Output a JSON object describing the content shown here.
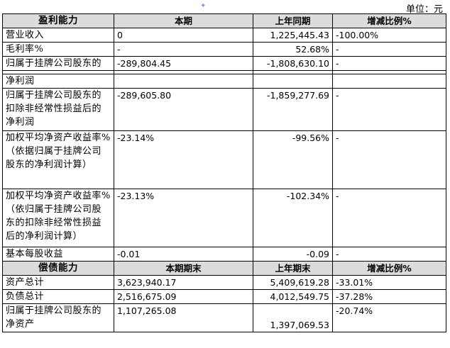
{
  "unit_label": "单位：元",
  "decor_mark": "✦",
  "profit": {
    "headers": [
      "盈利能力",
      "本期",
      "上年同期",
      "增减比例%"
    ],
    "rows": [
      {
        "label": "营业收入",
        "current": "0",
        "previous": "1,225,445.43",
        "change": "-100.00%"
      },
      {
        "label": "毛利率%",
        "current": "-",
        "previous": "52.68%",
        "change": "-"
      },
      {
        "label": "归属于挂牌公司股东的",
        "current": "-289,804.45",
        "previous": "-1,808,630.10",
        "change": "-"
      },
      {
        "label": "净利润",
        "current": "",
        "previous": "",
        "change": ""
      },
      {
        "label": "归属于挂牌公司股东的扣除非经常性损益后的净利润",
        "current": "-289,605.80",
        "previous": "-1,859,277.69",
        "change": "-"
      },
      {
        "label": "加权平均净资产收益率%（依据归属于挂牌公司股东的净利润计算）",
        "current": "-23.14%",
        "previous": "-99.56%",
        "change": "-"
      },
      {
        "label": "加权平均净资产收益率%（依归属于挂牌公司股东的扣除非经常性损益后的净利润计算）",
        "current": "-23.13%",
        "previous": "-102.34%",
        "change": "-"
      },
      {
        "label": "基本每股收益",
        "current": "-0.01",
        "previous": "-0.09",
        "change": "-"
      }
    ]
  },
  "solvency": {
    "headers": [
      "偿债能力",
      "本期期末",
      "上年期末",
      "增减比例%"
    ],
    "rows": [
      {
        "label": "资产总计",
        "current": "3,623,940.17",
        "previous": "5,409,619.28",
        "change": "-33.01%"
      },
      {
        "label": "负债总计",
        "current": "2,516,675.09",
        "previous": "4,012,549.75",
        "change": "-37.28%"
      },
      {
        "label": "归属于挂牌公司股东的净资产",
        "current": "1,107,265.08",
        "previous": "1,397,069.53",
        "change": "-20.74%"
      }
    ]
  }
}
